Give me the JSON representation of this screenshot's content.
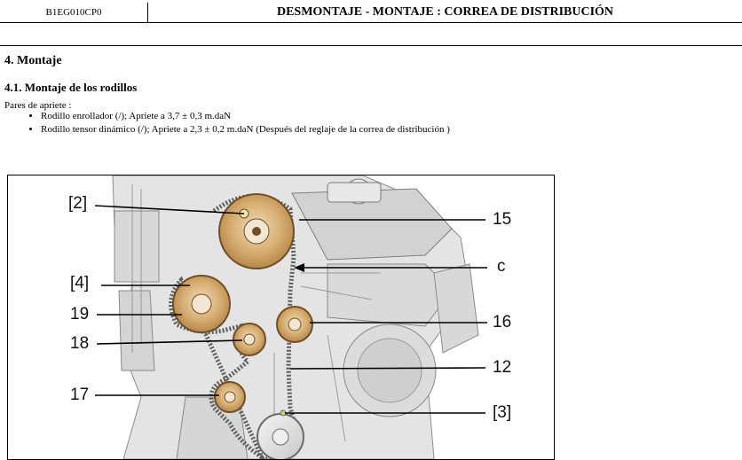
{
  "header": {
    "doc_code": "B1EG010CP0",
    "title": "DESMONTAJE - MONTAJE : CORREA DE DISTRIBUCIÓN"
  },
  "section": {
    "title": "4. Montaje",
    "subsection": "4.1. Montaje de los rodillos",
    "intro": "Pares de apriete :",
    "items": [
      "Rodillo enrollador (/); Apriete a 3,7 ± 0,3 m.daN",
      "Rodillo tensor dinámico (/); Apriete a 2,3 ± 0,2 m.daN (Después del reglaje de la correa de distribución )"
    ]
  },
  "figure": {
    "labels": {
      "l2": "[2]",
      "l4": "[4]",
      "l19": "19",
      "l18": "18",
      "l17": "17",
      "r15": "15",
      "rc": "c",
      "r16": "16",
      "r12": "12",
      "r3": "[3]"
    }
  }
}
